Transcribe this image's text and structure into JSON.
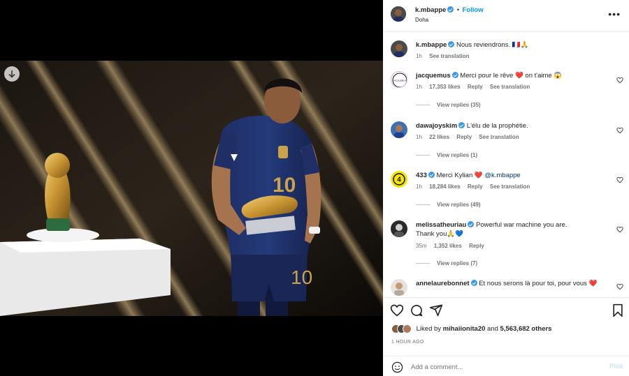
{
  "post": {
    "author": "k.mbappe",
    "location": "Doha",
    "follow_label": "Follow",
    "more_label": "•••"
  },
  "caption": {
    "username": "k.mbappe",
    "text": "Nous reviendrons. 🇫🇷🙏",
    "time": "1h",
    "see_translation": "See translation"
  },
  "comments": [
    {
      "username": "jacquemus",
      "verified": true,
      "text": "Merci pour le rêve ❤️ on t'aime 😱",
      "time": "1h",
      "likes": "17,353 likes",
      "reply": "Reply",
      "see_translation": "See translation",
      "view_replies": "View replies (35)"
    },
    {
      "username": "dawajoyskim",
      "verified": true,
      "text": "L'élu de la prophétie.",
      "time": "1h",
      "likes": "22 likes",
      "reply": "Reply",
      "see_translation": "See translation",
      "view_replies": "View replies (1)"
    },
    {
      "username": "433",
      "verified": true,
      "text": "Merci Kylian ❤️",
      "mention": "@k.mbappe",
      "time": "1h",
      "likes": "18,284 likes",
      "reply": "Reply",
      "see_translation": "See translation",
      "view_replies": "View replies (49)"
    },
    {
      "username": "melissatheuriau",
      "verified": true,
      "text": "Powerful war machine you are.",
      "text2": "Thank you🙏💙",
      "time": "35m",
      "likes": "1,352 likes",
      "reply": "Reply",
      "view_replies": "View replies (7)"
    },
    {
      "username": "annelaurebonnet",
      "verified": true,
      "text": "Et nous serons là pour toi, pour vous ❤️"
    }
  ],
  "likes": {
    "prefix": "Liked by",
    "user": "mihaiionita20",
    "and": "and",
    "others": "5,563,682 others"
  },
  "timestamp": "1 HOUR AGO",
  "add_comment": {
    "placeholder": "Add a comment...",
    "post_label": "Post"
  },
  "colors": {
    "accent": "#0095f6",
    "heart": "#ed4956",
    "verified": "#3897f0",
    "jersey": "#1b2a5e"
  }
}
